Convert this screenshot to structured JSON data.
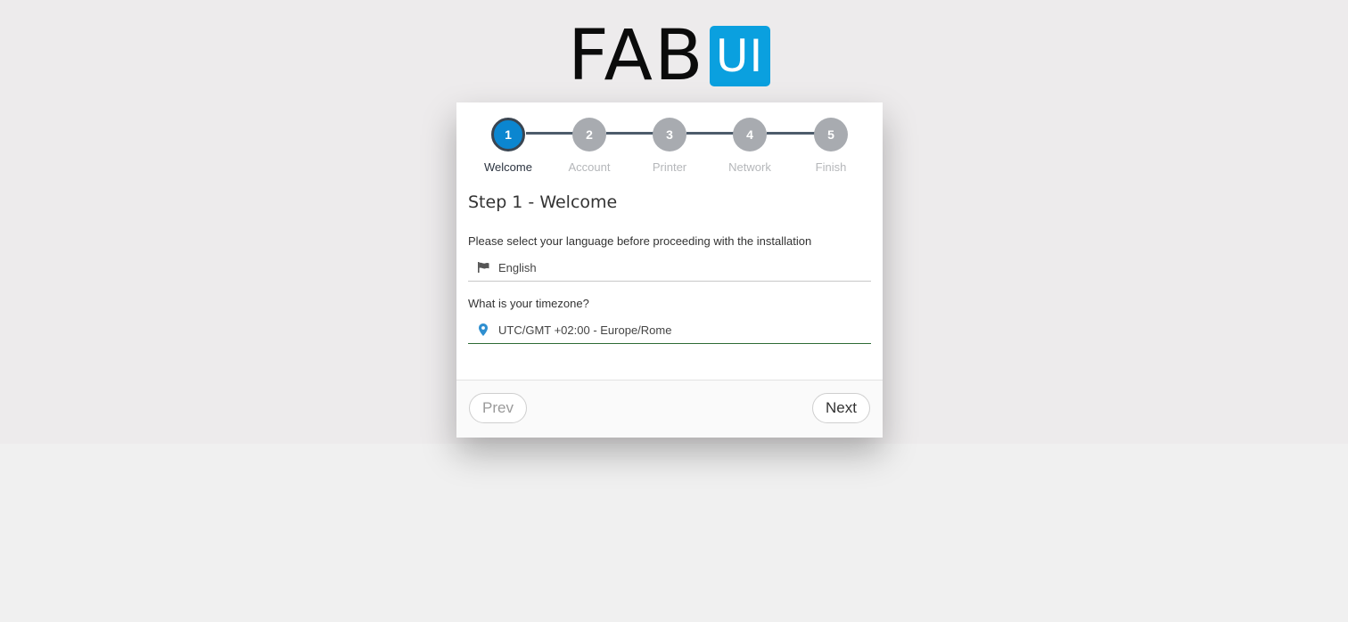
{
  "logo": {
    "text": "FAB",
    "badge": "UI",
    "badge_color": "#0aa0df"
  },
  "stepper": {
    "steps": [
      {
        "number": "1",
        "label": "Welcome",
        "active": true
      },
      {
        "number": "2",
        "label": "Account",
        "active": false
      },
      {
        "number": "3",
        "label": "Printer",
        "active": false
      },
      {
        "number": "4",
        "label": "Network",
        "active": false
      },
      {
        "number": "5",
        "label": "Finish",
        "active": false
      }
    ],
    "active_color": "#0b86d0",
    "inactive_color": "#a8abb0"
  },
  "content": {
    "title": "Step 1 - Welcome",
    "language": {
      "label": "Please select your language before proceeding with the installation",
      "value": "English",
      "icon": "flag-icon"
    },
    "timezone": {
      "label": "What is your timezone?",
      "value": "UTC/GMT +02:00 - Europe/Rome",
      "icon": "map-marker-icon"
    }
  },
  "footer": {
    "prev_label": "Prev",
    "next_label": "Next"
  }
}
